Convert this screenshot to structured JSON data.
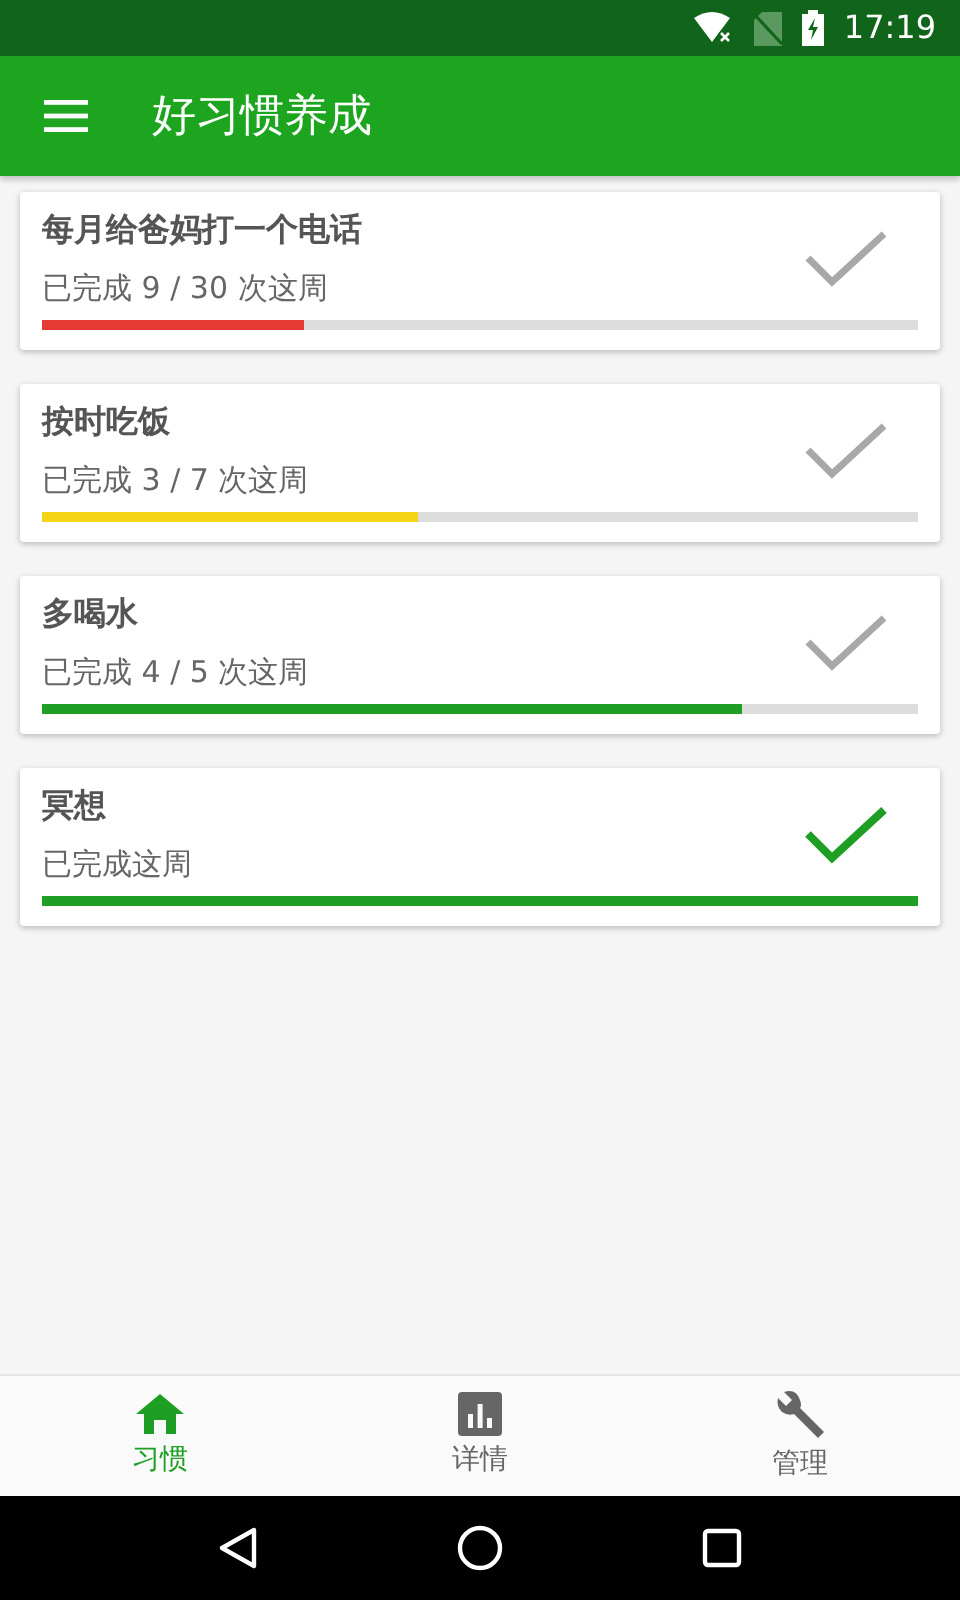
{
  "status_bar": {
    "time": "17:19"
  },
  "app_bar": {
    "title": "好习惯养成"
  },
  "habits": [
    {
      "name": "每月给爸妈打一个电话",
      "progress": "已完成 9 / 30 次这周",
      "level": 0.3,
      "color": "#e53935",
      "done": false
    },
    {
      "name": "按时吃饭",
      "progress": "已完成 3 / 7 次这周",
      "level": 0.43,
      "color": "#f5d415",
      "done": false
    },
    {
      "name": "多喝水",
      "progress": "已完成 4 / 5 次这周",
      "level": 0.8,
      "color": "#1e9e22",
      "done": false
    },
    {
      "name": "冥想",
      "progress": "已完成这周",
      "level": 1,
      "color": "#1e9e22",
      "done": true
    }
  ],
  "bottom_nav": [
    {
      "kind": "home",
      "label": "习惯",
      "selected": true
    },
    {
      "kind": "chart",
      "label": "详情",
      "selected": false
    },
    {
      "kind": "wrench",
      "label": "管理",
      "selected": false
    }
  ]
}
